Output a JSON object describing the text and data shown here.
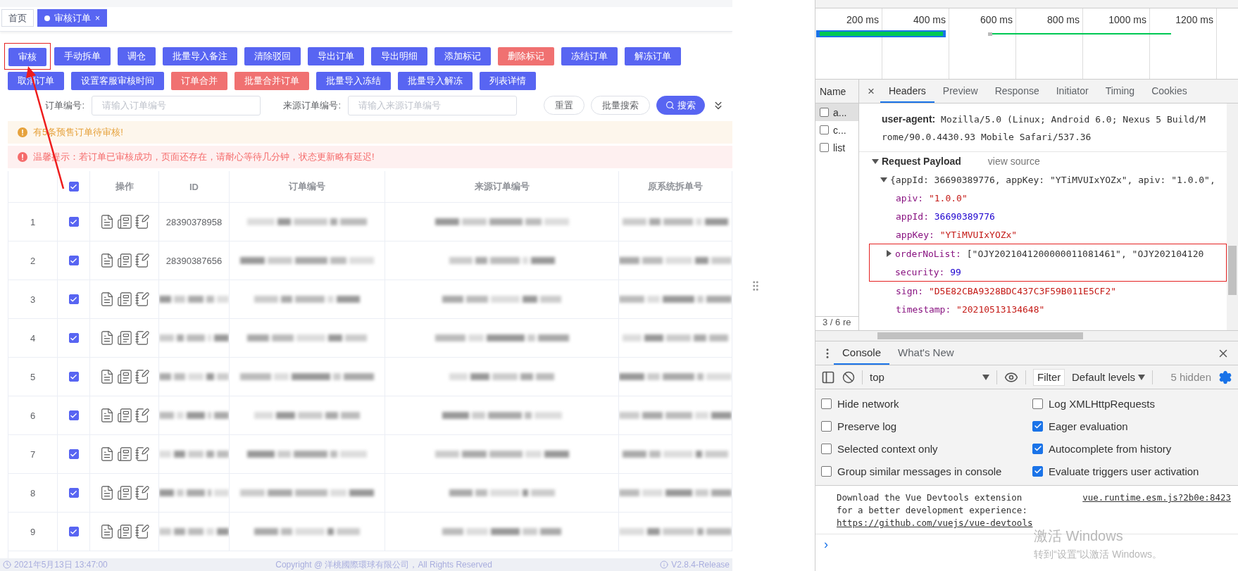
{
  "app": {
    "tabs": [
      {
        "label": "首页",
        "selected": false
      },
      {
        "label": "审核订单",
        "selected": true,
        "close": "×"
      }
    ],
    "toolbar_rows": [
      [
        {
          "label": "审核",
          "kind": "primary",
          "highlighted": true
        },
        {
          "label": "手动拆单",
          "kind": "primary",
          "highlighted": false
        },
        {
          "label": "调仓",
          "kind": "primary",
          "highlighted": false
        },
        {
          "label": "批量导入备注",
          "kind": "primary",
          "highlighted": false
        },
        {
          "label": "清除驳回",
          "kind": "primary",
          "highlighted": false
        },
        {
          "label": "导出订单",
          "kind": "primary",
          "highlighted": false
        },
        {
          "label": "导出明细",
          "kind": "primary",
          "highlighted": false
        },
        {
          "label": "添加标记",
          "kind": "primary",
          "highlighted": false
        },
        {
          "label": "删除标记",
          "kind": "danger",
          "highlighted": false
        },
        {
          "label": "冻结订单",
          "kind": "primary",
          "highlighted": false
        },
        {
          "label": "解冻订单",
          "kind": "primary",
          "highlighted": false
        }
      ],
      [
        {
          "label": "取消订单",
          "kind": "primary",
          "highlighted": false
        },
        {
          "label": "设置客服审核时间",
          "kind": "primary",
          "highlighted": false
        },
        {
          "label": "订单合并",
          "kind": "danger",
          "highlighted": false
        },
        {
          "label": "批量合并订单",
          "kind": "danger",
          "highlighted": false
        },
        {
          "label": "批量导入冻结",
          "kind": "primary",
          "highlighted": false
        },
        {
          "label": "批量导入解冻",
          "kind": "primary",
          "highlighted": false
        },
        {
          "label": "列表详情",
          "kind": "primary",
          "highlighted": false
        }
      ]
    ],
    "search_fields": [
      {
        "label": "订单编号:",
        "placeholder": "请输入订单编号"
      },
      {
        "label": "来源订单编号:",
        "placeholder": "请输入来源订单编号"
      }
    ],
    "search_buttons": [
      {
        "label": "重置",
        "kind": "plain"
      },
      {
        "label": "批量搜索",
        "kind": "plain"
      },
      {
        "label": "搜索",
        "kind": "primary"
      }
    ],
    "alerts": [
      {
        "kind": "warning",
        "text": "有5条预售订单待审核!"
      },
      {
        "kind": "error",
        "text": "温馨提示：若订单已审核成功，页面还存在，请耐心等待几分钟，状态更新略有延迟!"
      }
    ],
    "table": {
      "select_all_checked": true,
      "columns": [
        "操作",
        "ID",
        "订单编号",
        "来源订单编号",
        "原系统拆单号"
      ],
      "rows": [
        {
          "index": "1",
          "checked": true,
          "cells": [
            {
              "kind": "text",
              "text": "28390378958"
            },
            {
              "kind": "redacted"
            },
            {
              "kind": "redacted"
            },
            {
              "kind": "redacted"
            }
          ]
        },
        {
          "index": "2",
          "checked": true,
          "cells": [
            {
              "kind": "text",
              "text": "28390387656"
            },
            {
              "kind": "redacted"
            },
            {
              "kind": "redacted"
            },
            {
              "kind": "redacted"
            }
          ]
        },
        {
          "index": "3",
          "checked": true,
          "cells": [
            {
              "kind": "redacted"
            },
            {
              "kind": "redacted"
            },
            {
              "kind": "redacted"
            },
            {
              "kind": "redacted"
            }
          ]
        },
        {
          "index": "4",
          "checked": true,
          "cells": [
            {
              "kind": "redacted"
            },
            {
              "kind": "redacted"
            },
            {
              "kind": "redacted"
            },
            {
              "kind": "redacted"
            }
          ]
        },
        {
          "index": "5",
          "checked": true,
          "cells": [
            {
              "kind": "redacted"
            },
            {
              "kind": "redacted"
            },
            {
              "kind": "redacted"
            },
            {
              "kind": "redacted"
            }
          ]
        },
        {
          "index": "6",
          "checked": true,
          "cells": [
            {
              "kind": "redacted"
            },
            {
              "kind": "redacted"
            },
            {
              "kind": "redacted"
            },
            {
              "kind": "redacted"
            }
          ]
        },
        {
          "index": "7",
          "checked": true,
          "cells": [
            {
              "kind": "redacted"
            },
            {
              "kind": "redacted"
            },
            {
              "kind": "redacted"
            },
            {
              "kind": "redacted"
            }
          ]
        },
        {
          "index": "8",
          "checked": true,
          "cells": [
            {
              "kind": "redacted"
            },
            {
              "kind": "redacted"
            },
            {
              "kind": "redacted"
            },
            {
              "kind": "redacted"
            }
          ]
        },
        {
          "index": "9",
          "checked": true,
          "cells": [
            {
              "kind": "redacted"
            },
            {
              "kind": "redacted"
            },
            {
              "kind": "redacted"
            },
            {
              "kind": "redacted"
            }
          ]
        }
      ]
    },
    "footer": {
      "time": "2021年5月13日 13:47:00",
      "copyright": "Copyright @ 洋桃國際環球有限公司，All Rights Reserved",
      "version": "V2.8.4-Release"
    }
  },
  "devtools": {
    "overview": {
      "ticks": [
        "200 ms",
        "400 ms",
        "600 ms",
        "800 ms",
        "1000 ms",
        "1200 ms"
      ]
    },
    "network": {
      "name_header": "Name",
      "requests": [
        {
          "name": "a...",
          "selected": true
        },
        {
          "name": "c...",
          "selected": false
        },
        {
          "name": "list",
          "selected": false
        }
      ],
      "status": "3 / 6 re",
      "close": "×",
      "detail_tabs": [
        {
          "label": "Headers",
          "selected": true
        },
        {
          "label": "Preview",
          "selected": false
        },
        {
          "label": "Response",
          "selected": false
        },
        {
          "label": "Initiator",
          "selected": false
        },
        {
          "label": "Timing",
          "selected": false
        },
        {
          "label": "Cookies",
          "selected": false
        }
      ],
      "user_agent_key": "user-agent:",
      "user_agent_lines": [
        "Mozilla/5.0 (Linux; Android 6.0; Nexus 5 Build/M",
        "rome/90.0.4430.93 Mobile Safari/537.36"
      ],
      "payload": {
        "title": "Request Payload",
        "view_source": "view source",
        "expanded": true,
        "summary": "{appId: 36690389776, appKey: \"YTiMVUIxYOZx\", apiv: \"1.0.0\",",
        "properties": [
          {
            "key": "apiv:",
            "value": "\"1.0.0\"",
            "kind": "string",
            "highlighted": false
          },
          {
            "key": "appId:",
            "value": "36690389776",
            "kind": "number",
            "highlighted": false
          },
          {
            "key": "appKey:",
            "value": "\"YTiMVUIxYOZx\"",
            "kind": "string",
            "highlighted": false
          },
          {
            "key": "orderNoList:",
            "value": "[\"OJY2021041200000011081461\", \"OJY202104120",
            "kind": "array",
            "highlighted": true
          },
          {
            "key": "security:",
            "value": "99",
            "kind": "number",
            "highlighted": true
          },
          {
            "key": "sign:",
            "value": "\"D5E82CBA9328BDC437C3F59B011E5CF2\"",
            "kind": "string",
            "highlighted": false
          },
          {
            "key": "timestamp:",
            "value": "\"20210513134648\"",
            "kind": "string",
            "highlighted": false
          }
        ]
      }
    },
    "console": {
      "tabs": [
        {
          "label": "Console",
          "selected": true
        },
        {
          "label": "What's New",
          "selected": false
        }
      ],
      "context": "top",
      "filter_placeholder": "Filter",
      "levels": "Default levels",
      "hidden": "5 hidden",
      "settings": [
        {
          "label": "Hide network",
          "checked": false
        },
        {
          "label": "Log XMLHttpRequests",
          "checked": false
        },
        {
          "label": "Preserve log",
          "checked": false
        },
        {
          "label": "Eager evaluation",
          "checked": true
        },
        {
          "label": "Selected context only",
          "checked": false
        },
        {
          "label": "Autocomplete from history",
          "checked": true
        },
        {
          "label": "Group similar messages in console",
          "checked": false
        },
        {
          "label": "Evaluate triggers user activation",
          "checked": true
        }
      ],
      "messages": [
        {
          "lines": [
            "Download the Vue Devtools extension",
            "for a better development experience:"
          ],
          "source": "vue.runtime.esm.js?2b0e:8423",
          "link": "https://github.com/vuejs/vue-devtools"
        }
      ],
      "prompt": "›"
    },
    "os_watermark": {
      "title": "激活 Windows",
      "subtitle": "转到“设置”以激活 Windows。"
    }
  }
}
